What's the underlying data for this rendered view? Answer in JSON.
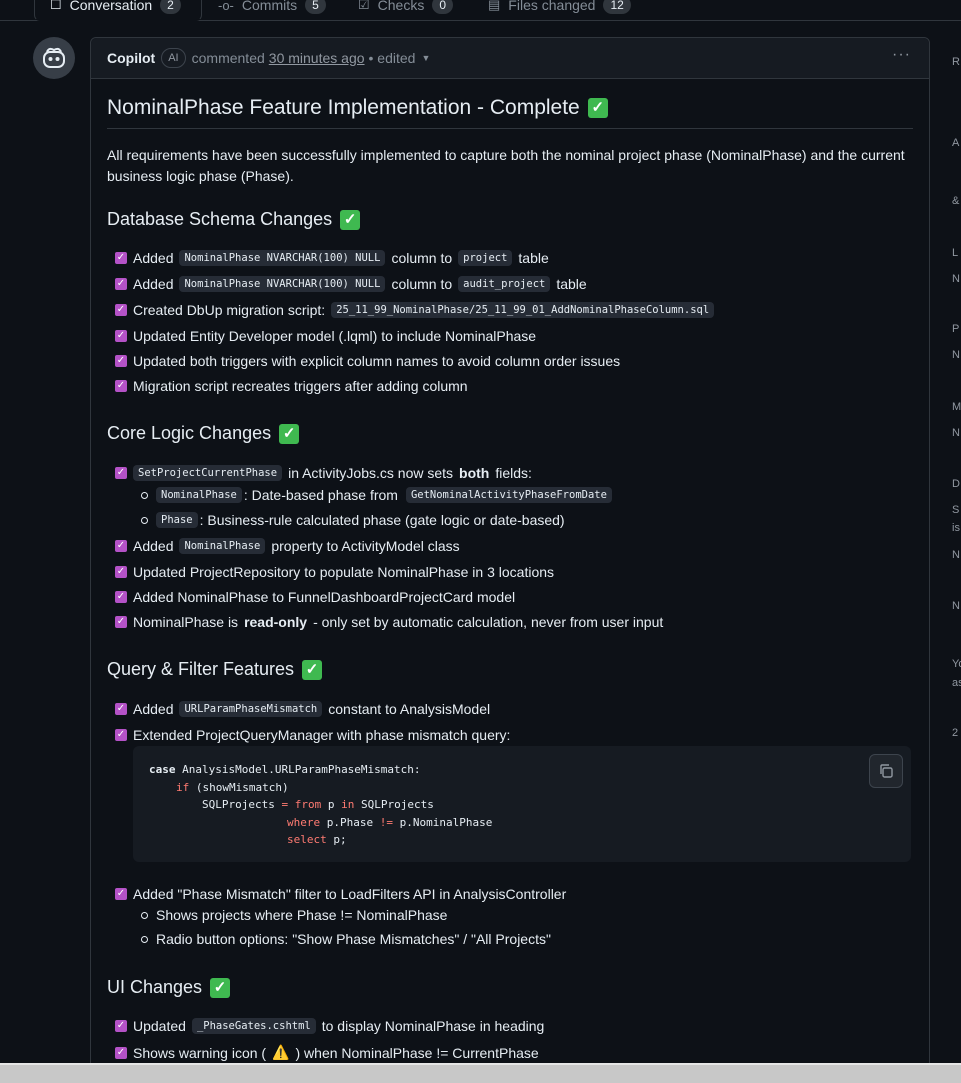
{
  "tabs": [
    {
      "label": "Conversation",
      "count": "2",
      "icon": "conversation-icon"
    },
    {
      "label": "Commits",
      "count": "5",
      "icon": "commit-icon"
    },
    {
      "label": "Checks",
      "count": "0",
      "icon": "checks-icon"
    },
    {
      "label": "Files changed",
      "count": "12",
      "icon": "file-diff-icon"
    }
  ],
  "comment": {
    "author": "Copilot",
    "badge": "AI",
    "action": "commented",
    "timestamp": "30 minutes ago",
    "edited": "• edited",
    "title": "NominalPhase Feature Implementation - Complete",
    "intro": "All requirements have been successfully implemented to capture both the nominal project phase (NominalPhase) and the current business logic phase (Phase).",
    "db": {
      "heading": "Database Schema Changes",
      "items": [
        {
          "pre": "Added",
          "code": "NominalPhase NVARCHAR(100) NULL",
          "mid": "column to",
          "code2": "project",
          "post": "table"
        },
        {
          "pre": "Added",
          "code": "NominalPhase NVARCHAR(100) NULL",
          "mid": "column to",
          "code2": "audit_project",
          "post": "table"
        },
        {
          "pre": "Created DbUp migration script:",
          "code": "25_11_99_NominalPhase/25_11_99_01_AddNominalPhaseColumn.sql"
        },
        {
          "text": "Updated Entity Developer model (.lqml) to include NominalPhase"
        },
        {
          "text": "Updated both triggers with explicit column names to avoid column order issues"
        },
        {
          "text": "Migration script recreates triggers after adding column"
        }
      ]
    },
    "core": {
      "heading": "Core Logic Changes",
      "item1_code": "SetProjectCurrentPhase",
      "item1_text": "in ActivityJobs.cs now sets",
      "item1_bold": "both",
      "item1_post": "fields:",
      "sub1_code": "NominalPhase",
      "sub1_text": ": Date-based phase from",
      "sub1_code2": "GetNominalActivityPhaseFromDate",
      "sub2_code": "Phase",
      "sub2_text": ": Business-rule calculated phase (gate logic or date-based)",
      "item2_pre": "Added",
      "item2_code": "NominalPhase",
      "item2_post": "property to ActivityModel class",
      "item3": "Updated ProjectRepository to populate NominalPhase in 3 locations",
      "item4": "Added NominalPhase to FunnelDashboardProjectCard model",
      "item5_pre": "NominalPhase is",
      "item5_bold": "read-only",
      "item5_post": "- only set by automatic calculation, never from user input"
    },
    "query": {
      "heading": "Query & Filter Features",
      "item1_pre": "Added",
      "item1_code": "URLParamPhaseMismatch",
      "item1_post": "constant to AnalysisModel",
      "item2": "Extended ProjectQueryManager with phase mismatch query:",
      "code_lines": {
        "l1_kw": "case",
        "l1": " AnalysisModel.URLParamPhaseMismatch:",
        "l2_kw": "if",
        "l2": " (showMismatch)",
        "l3a": "SQLProjects ",
        "l3_op": "=",
        "l3_kw": " from",
        "l3b": " p ",
        "l3_kw2": "in",
        "l3c": " SQLProjects",
        "l4_kw": "where",
        "l4a": " p.Phase ",
        "l4_op": "!=",
        "l4b": " p.NominalPhase",
        "l5_kw": "select",
        "l5": " p;"
      },
      "item3": "Added \"Phase Mismatch\" filter to LoadFilters API in AnalysisController",
      "sub1": "Shows projects where Phase != NominalPhase",
      "sub2": "Radio button options: \"Show Phase Mismatches\" / \"All Projects\""
    },
    "ui": {
      "heading": "UI Changes",
      "item1_pre": "Updated",
      "item1_code": "_PhaseGates.cshtml",
      "item1_post": "to display NominalPhase in heading",
      "item2_pre": "Shows warning icon (",
      "item2_icon": "⚠️",
      "item2_post": ") when NominalPhase != CurrentPhase"
    }
  },
  "sidebar_fragments": [
    "R",
    "A",
    "&",
    "L",
    "N",
    "P",
    "N",
    "M",
    "N",
    "D",
    "S",
    "is",
    "N",
    "N",
    "Yo",
    "as",
    "2"
  ],
  "colors": {
    "bg": "#0d1117",
    "check": "#3fb950",
    "checkbox": "#b452c7",
    "keyword": "#ff7b72"
  }
}
